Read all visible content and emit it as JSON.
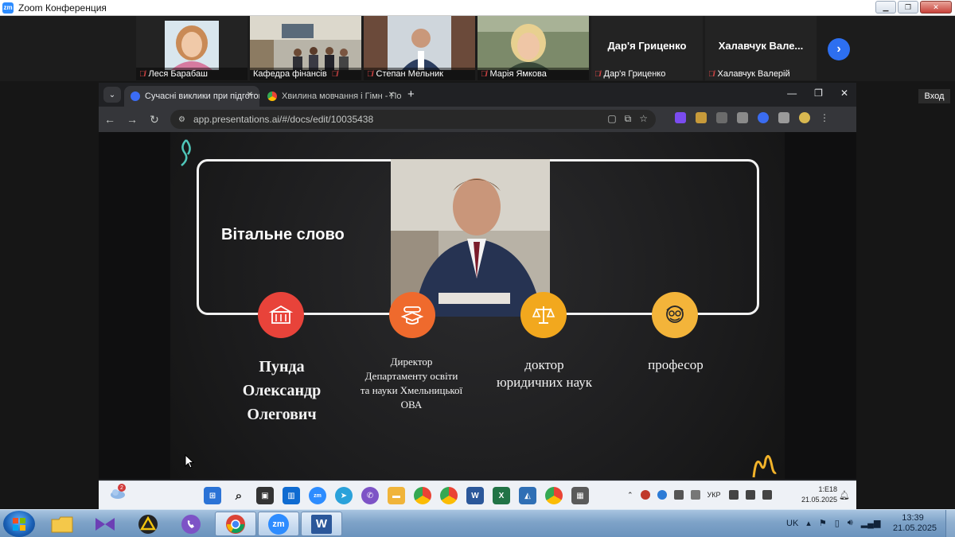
{
  "zoom": {
    "title": "Zoom Конференция",
    "logo": "zm"
  },
  "participants": [
    {
      "name": "Леся Барабаш",
      "muted": true
    },
    {
      "name": "Кафедра фінансів",
      "muted": true
    },
    {
      "name": "Степан Мельник",
      "muted": true
    },
    {
      "name": "Марія Ямкова",
      "muted": true
    },
    {
      "name": "Дар'я Гриценко",
      "display_name": "Дар'я Гриценко",
      "muted": true
    },
    {
      "name": "Халавчук Валерій",
      "display_name": "Халавчук Вале...",
      "muted": true
    }
  ],
  "tooltip": "Вход",
  "chrome": {
    "tabs": [
      {
        "title": "Сучасні виклики при підготов",
        "active": true
      },
      {
        "title": "Хвилина мовчання і Гімн - Пош",
        "active": false
      }
    ],
    "url": "app.presentations.ai/#/docs/edit/10035438"
  },
  "slide": {
    "title": "Вітальне слово",
    "name": "Пунда Олександр Олеговичч",
    "name_lines": [
      "Пунда",
      "Олександр",
      "Олегович"
    ],
    "position_lines": [
      "Директор",
      "Департаменту освіти",
      "та науки Хмельницької",
      "ОВА"
    ],
    "degree_lines": [
      "доктор",
      "юридичних наук"
    ],
    "title_academic": "професор",
    "circle_colors": [
      "#e8433a",
      "#ef6a2d",
      "#f2a81e",
      "#f3b43a"
    ]
  },
  "remote_taskbar": {
    "weather_badge": "2",
    "lang": "УКР",
    "time": "1:E18",
    "date": "21.05.2025"
  },
  "local_taskbar": {
    "lang": "UK",
    "time": "13:39",
    "date": "21.05.2025"
  }
}
